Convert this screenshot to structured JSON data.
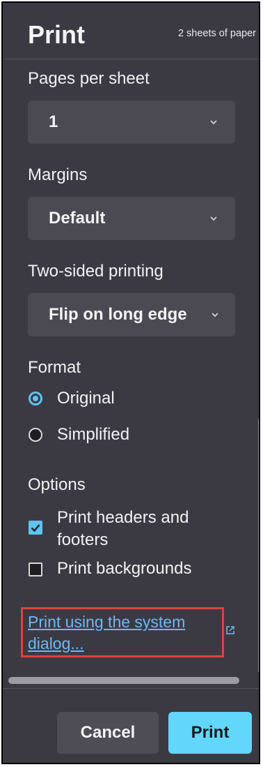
{
  "header": {
    "title": "Print",
    "sheets_info": "2 sheets of paper"
  },
  "pages_per_sheet": {
    "label": "Pages per sheet",
    "value": "1"
  },
  "margins": {
    "label": "Margins",
    "value": "Default"
  },
  "two_sided": {
    "label": "Two-sided printing",
    "value": "Flip on long edge"
  },
  "format": {
    "label": "Format",
    "options": [
      {
        "label": "Original",
        "selected": true
      },
      {
        "label": "Simplified",
        "selected": false
      }
    ]
  },
  "options": {
    "label": "Options",
    "items": [
      {
        "label": "Print headers and footers",
        "checked": true
      },
      {
        "label": "Print backgrounds",
        "checked": false
      }
    ]
  },
  "system_dialog_link": "Print using the system dialog...",
  "buttons": {
    "cancel": "Cancel",
    "print": "Print"
  },
  "icons": {
    "dropdown": "chevron-down-icon",
    "radio_on": "radio-selected-icon",
    "radio_off": "radio-unselected-icon",
    "check_on": "checkbox-checked-icon",
    "check_off": "checkbox-unchecked-icon",
    "external": "external-link-icon"
  },
  "colors": {
    "panel_bg": "#3b3a42",
    "control_bg": "#4b4a52",
    "accent": "#5fc3f0",
    "primary_button": "#62d6fb",
    "link": "#6fb7f5",
    "highlight_box": "#e0413f"
  }
}
